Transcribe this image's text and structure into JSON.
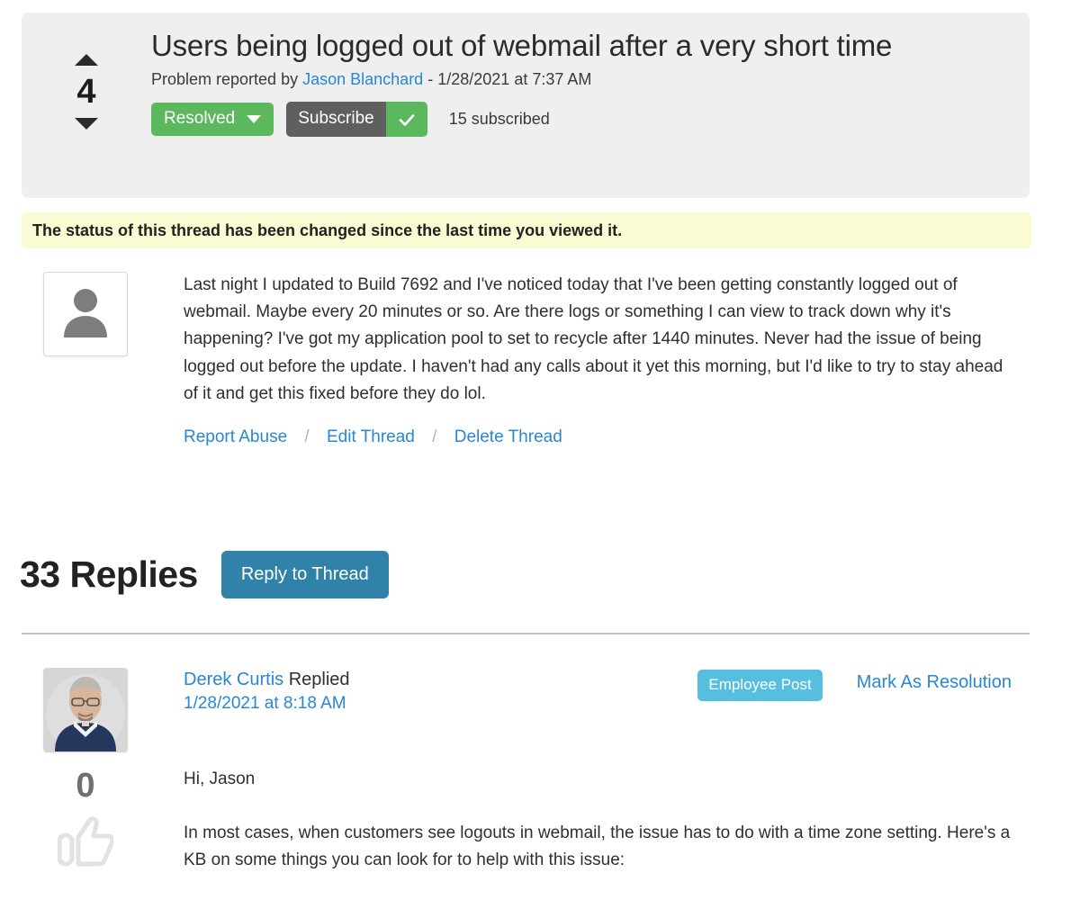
{
  "thread": {
    "vote_score": "4",
    "vote_up_icon": "triangle-up-icon",
    "vote_down_icon": "triangle-down-icon",
    "title": "Users being logged out of webmail after a very short time",
    "meta_prefix": "Problem reported by",
    "author": "Jason Blanchard",
    "meta_separator": "-",
    "timestamp": "1/28/2021 at 7:37 AM",
    "status_button": "Resolved",
    "status_caret_icon": "caret-down-icon",
    "subscribe_button": "Subscribe",
    "subscribe_check_icon": "check-icon",
    "subscribed_count": "15 subscribed"
  },
  "banner": {
    "message": "The status of this thread has been changed since the last time you viewed it."
  },
  "original_post": {
    "avatar_icon": "default-user-avatar-icon",
    "body": "Last night I updated to Build 7692 and I've noticed today that I've been getting constantly logged out of webmail. Maybe every 20 minutes or so. Are there logs or something I can view to track down why it's happening? I've got my application pool to set to recycle after 1440 minutes. Never had the issue of being logged out before the update. I haven't had any calls about it yet this morning, but I'd like to try to stay ahead of it and get this fixed before they do lol.",
    "links": {
      "report_abuse": "Report Abuse",
      "edit_thread": "Edit Thread",
      "delete_thread": "Delete Thread",
      "separator": "/"
    }
  },
  "replies_section": {
    "count_label": "33 Replies",
    "reply_button": "Reply to Thread"
  },
  "replies": [
    {
      "avatar_icon": "user-photo-avatar",
      "vote_count": "0",
      "thumb_icon": "thumbs-up-icon",
      "author": "Derek Curtis",
      "action_word": "Replied",
      "timestamp": "1/28/2021 at 8:18 AM",
      "badge": "Employee Post",
      "mark_resolution": "Mark As Resolution",
      "greeting": "Hi, Jason",
      "body": "In most cases, when customers see logouts in webmail, the issue has to do with a time zone setting. Here's a KB on some things you can look for to help with this issue:"
    }
  ],
  "colors": {
    "panel_bg": "#efefef",
    "banner_bg": "#fbfbd3",
    "link_blue": "#2787d4",
    "status_green": "#5cb85c",
    "subscribe_gray": "#5f5f5f",
    "reply_button_blue": "#3082a8",
    "employee_badge_blue": "#56bfe0"
  }
}
